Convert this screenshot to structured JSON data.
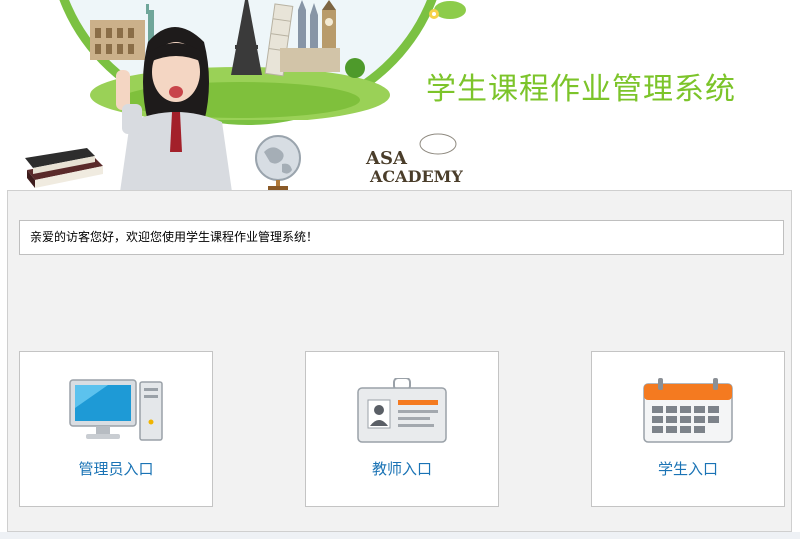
{
  "header": {
    "title": "学生课程作业管理系统",
    "logo_line1": "ASA",
    "logo_line2": "ACADEMY",
    "accent_color": "#7cc42a"
  },
  "welcome": {
    "message": "亲爱的访客您好，欢迎您使用学生课程作业管理系统！"
  },
  "entries": [
    {
      "label": "管理员入口",
      "icon": "computer-icon"
    },
    {
      "label": "教师入口",
      "icon": "id-card-icon"
    },
    {
      "label": "学生入口",
      "icon": "calendar-icon"
    }
  ],
  "colors": {
    "link": "#1a73b5",
    "panel_bg": "#f2f2f2",
    "calendar_orange": "#f47a20"
  }
}
